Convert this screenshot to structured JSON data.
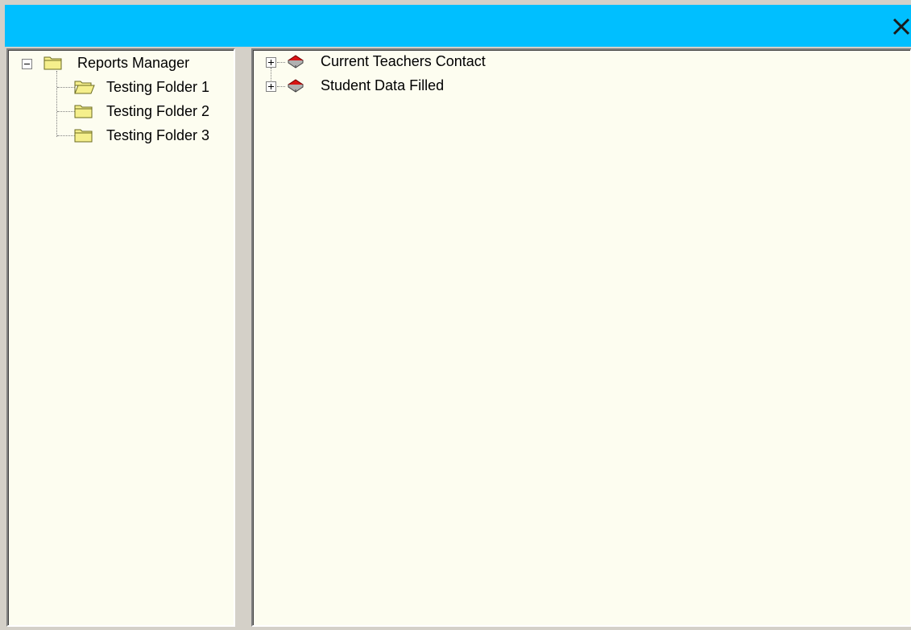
{
  "window": {
    "titlebar_color": "#00bfff",
    "close_icon": "close-icon"
  },
  "left_tree": {
    "root": {
      "label": "Reports Manager",
      "icon": "folder-icon",
      "expanded": true
    },
    "children": [
      {
        "label": "Testing Folder 1",
        "icon": "folder-open-icon"
      },
      {
        "label": "Testing Folder 2",
        "icon": "folder-icon"
      },
      {
        "label": "Testing Folder 3",
        "icon": "folder-icon"
      }
    ]
  },
  "right_tree": {
    "items": [
      {
        "label": "Current Teachers Contact",
        "icon": "book-icon",
        "expanded": false
      },
      {
        "label": "Student Data Filled",
        "icon": "book-icon",
        "expanded": false
      }
    ]
  }
}
